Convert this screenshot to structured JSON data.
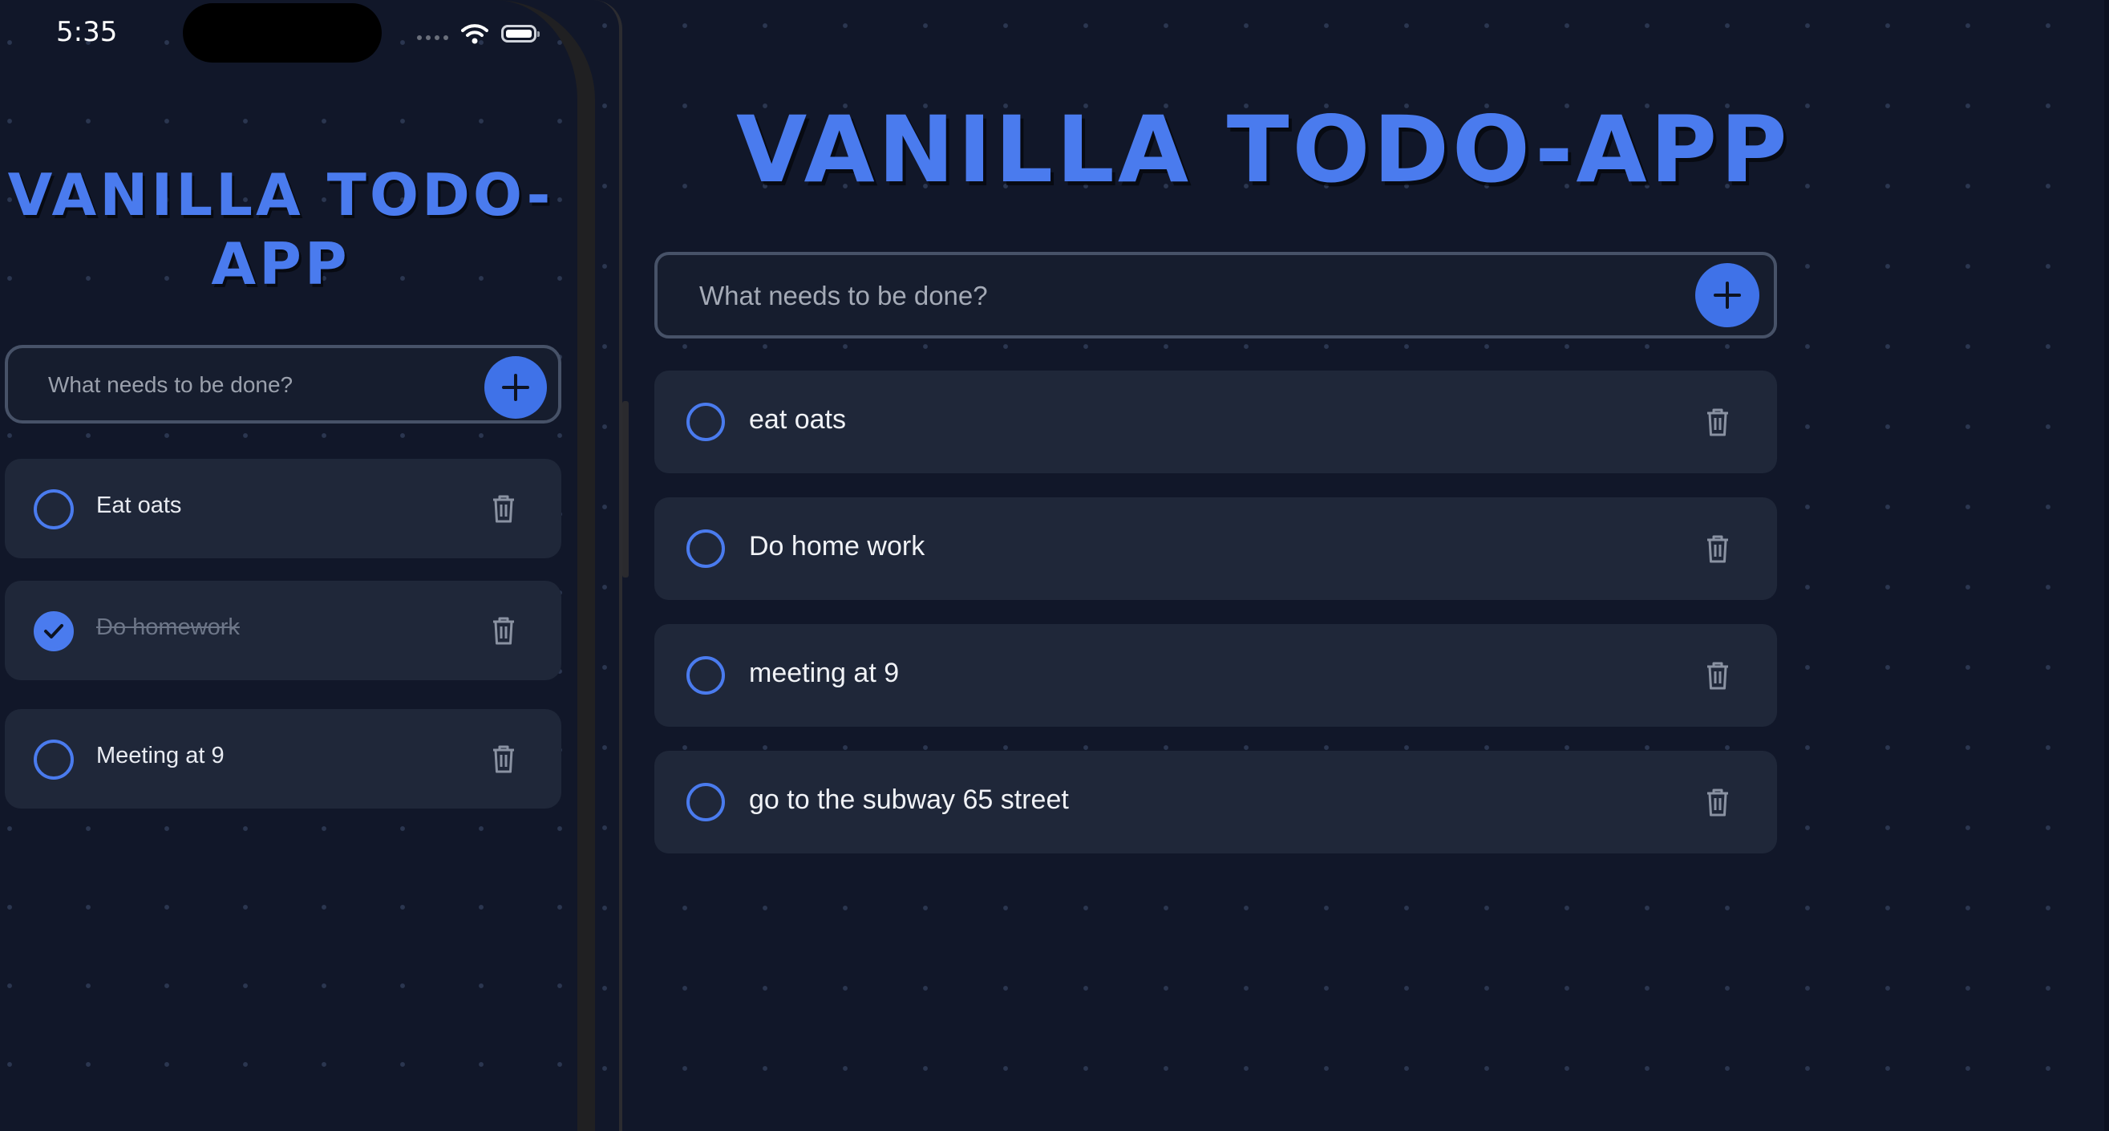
{
  "mobile": {
    "status_bar": {
      "time": "5:35"
    },
    "title": "VANILLA TODO-APP",
    "input": {
      "placeholder": "What needs to be done?",
      "value": ""
    },
    "add_icon": "plus-icon",
    "todos": [
      {
        "text": "Eat oats",
        "done": false
      },
      {
        "text": "Do homework",
        "done": true
      },
      {
        "text": "Meeting at 9",
        "done": false
      }
    ]
  },
  "desktop": {
    "title": "VANILLA TODO-APP",
    "input": {
      "placeholder": "What needs to be done?",
      "value": ""
    },
    "add_icon": "plus-icon",
    "todos": [
      {
        "text": "eat oats",
        "done": false
      },
      {
        "text": "Do home work",
        "done": false
      },
      {
        "text": "meeting at 9",
        "done": false
      },
      {
        "text": "go to the subway 65 street",
        "done": false
      }
    ]
  },
  "colors": {
    "background": "#111729",
    "accent": "#4a7bee",
    "card": "#1f2739",
    "text": "#f0f2f6",
    "muted": "#6d7688"
  }
}
